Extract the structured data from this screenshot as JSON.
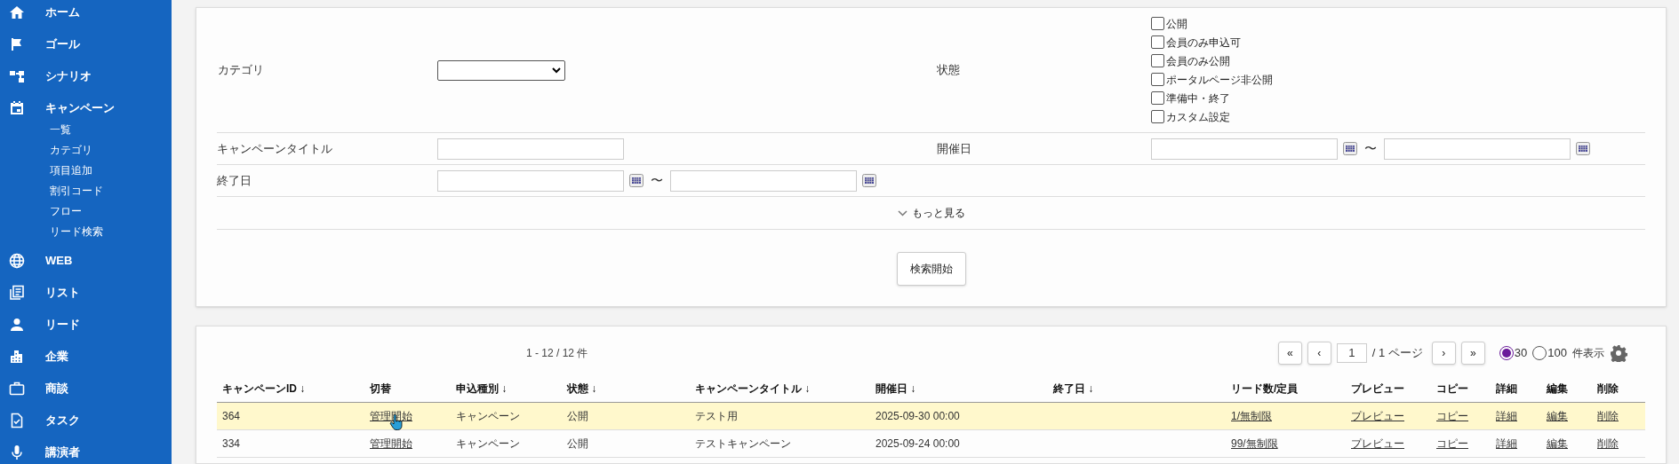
{
  "sidebar": {
    "items": [
      {
        "label": "ホーム"
      },
      {
        "label": "ゴール"
      },
      {
        "label": "シナリオ"
      },
      {
        "label": "キャンペーン",
        "children": [
          {
            "label": "一覧"
          },
          {
            "label": "カテゴリ"
          },
          {
            "label": "項目追加"
          },
          {
            "label": "割引コード"
          },
          {
            "label": "フロー"
          },
          {
            "label": "リード検索"
          }
        ]
      },
      {
        "label": "WEB"
      },
      {
        "label": "リスト"
      },
      {
        "label": "リード"
      },
      {
        "label": "企業"
      },
      {
        "label": "商談"
      },
      {
        "label": "タスク"
      },
      {
        "label": "講演者"
      }
    ]
  },
  "filters": {
    "category": {
      "label": "カテゴリ"
    },
    "status": {
      "label": "状態",
      "options": [
        {
          "label": "公開",
          "checked": false
        },
        {
          "label": "会員のみ申込可",
          "checked": false
        },
        {
          "label": "会員のみ公開",
          "checked": false
        },
        {
          "label": "ポータルページ非公開",
          "checked": false
        },
        {
          "label": "準備中・終了",
          "checked": false
        },
        {
          "label": "カスタム設定",
          "checked": false
        }
      ]
    },
    "campaign_title": {
      "label": "キャンペーンタイトル"
    },
    "start_date": {
      "label": "開催日",
      "separator": "〜"
    },
    "end_date": {
      "label": "終了日",
      "separator": "〜"
    },
    "more_link": "もっと見る",
    "search_button": "検索開始"
  },
  "results": {
    "count": "1 - 12 / 12 件",
    "pagination": {
      "first": "«",
      "prev": "‹",
      "page": "1",
      "total": "/ 1 ページ",
      "next": "›",
      "last": "»"
    },
    "page_size": {
      "options": [
        {
          "label": "30",
          "selected": true
        },
        {
          "label": "100",
          "selected": false
        }
      ],
      "suffix": "件表示"
    },
    "columns": [
      {
        "label": "キャンペーンID ↓",
        "kind": "text"
      },
      {
        "label": "切替",
        "kind": "link"
      },
      {
        "label": "申込種別 ↓",
        "kind": "text"
      },
      {
        "label": "状態 ↓",
        "kind": "text"
      },
      {
        "label": "キャンペーンタイトル ↓",
        "kind": "text"
      },
      {
        "label": "開催日 ↓",
        "kind": "text"
      },
      {
        "label": "終了日 ↓"
      },
      {
        "label": "リード数/定員",
        "kind": "link"
      },
      {
        "label": "プレビュー",
        "kind": "link"
      },
      {
        "label": "コピー",
        "kind": "link"
      },
      {
        "label": "詳細",
        "kind": "link"
      },
      {
        "label": "編集",
        "kind": "link"
      },
      {
        "label": "削除",
        "kind": "link"
      }
    ],
    "rows": [
      {
        "hovered": true,
        "cells": [
          "364",
          "管理開始",
          "キャンペーン",
          "公開",
          "テスト用",
          "2025-09-30 00:00",
          null,
          "1/無制限",
          "プレビュー",
          "コピー",
          "詳細",
          "編集",
          "削除"
        ]
      },
      {
        "hovered": false,
        "cells": [
          "334",
          "管理開始",
          "キャンペーン",
          "公開",
          "テストキャンペーン",
          "2025-09-24 00:00",
          null,
          "99/無制限",
          "プレビュー",
          "コピー",
          "詳細",
          "編集",
          "削除"
        ]
      }
    ]
  }
}
